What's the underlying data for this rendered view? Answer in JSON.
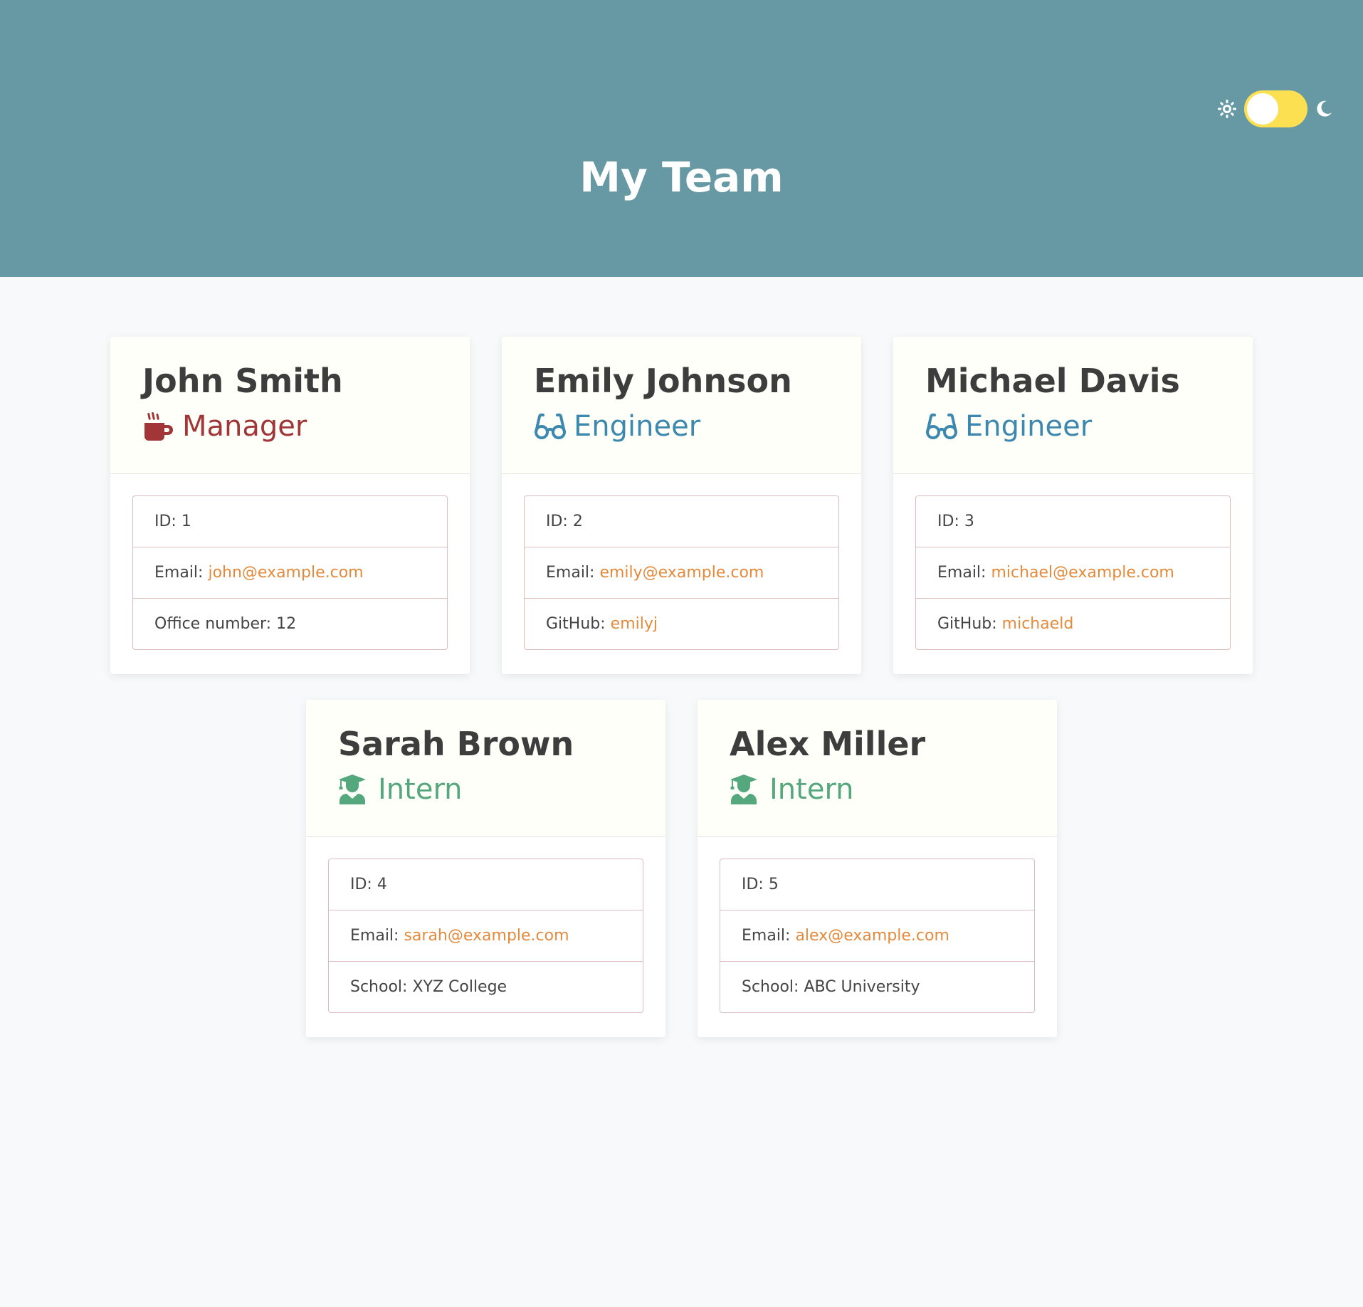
{
  "header": {
    "title": "My Team",
    "background": "#6799a5"
  },
  "theme_toggle": {
    "sun_icon": "sun-icon",
    "moon_icon": "moon-icon",
    "track_color": "#fde052"
  },
  "colors": {
    "manager": "#a13537",
    "engineer": "#3d88ae",
    "intern": "#55a77d",
    "link": "#e48a3c"
  },
  "cards": [
    {
      "name": "John Smith",
      "role": "Manager",
      "role_icon": "coffee-mug-icon",
      "id_label": "ID: 1",
      "email_label": "Email: ",
      "email": "john@example.com",
      "extra_label": "Office number: 12"
    },
    {
      "name": "Emily Johnson",
      "role": "Engineer",
      "role_icon": "glasses-icon",
      "id_label": "ID: 2",
      "email_label": "Email: ",
      "email": "emily@example.com",
      "extra_label": "GitHub: ",
      "extra_link": "emilyj"
    },
    {
      "name": "Michael Davis",
      "role": "Engineer",
      "role_icon": "glasses-icon",
      "id_label": "ID: 3",
      "email_label": "Email: ",
      "email": "michael@example.com",
      "extra_label": "GitHub: ",
      "extra_link": "michaeld"
    },
    {
      "name": "Sarah Brown",
      "role": "Intern",
      "role_icon": "graduate-icon",
      "id_label": "ID: 4",
      "email_label": "Email: ",
      "email": "sarah@example.com",
      "extra_label": "School: XYZ College"
    },
    {
      "name": "Alex Miller",
      "role": "Intern",
      "role_icon": "graduate-icon",
      "id_label": "ID: 5",
      "email_label": "Email: ",
      "email": "alex@example.com",
      "extra_label": "School: ABC University"
    }
  ]
}
